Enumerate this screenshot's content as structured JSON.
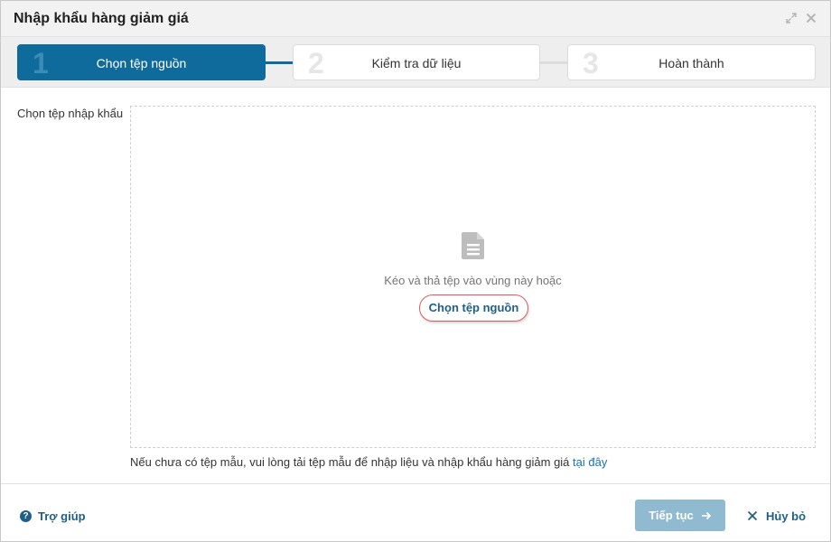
{
  "dialog": {
    "title": "Nhập khẩu hàng giảm giá",
    "expand_icon": "expand-icon",
    "close_icon": "close-icon"
  },
  "steps": [
    {
      "number": "1",
      "label": "Chọn tệp nguồn",
      "active": true
    },
    {
      "number": "2",
      "label": "Kiểm tra dữ liệu",
      "active": false
    },
    {
      "number": "3",
      "label": "Hoàn thành",
      "active": false
    }
  ],
  "upload": {
    "field_label": "Chọn tệp nhập khẩu",
    "drop_text": "Kéo và thả tệp vào vùng này hoặc",
    "choose_label": "Chọn tệp nguồn",
    "file_icon": "document-icon"
  },
  "hint": {
    "text": "Nếu chưa có tệp mẫu, vui lòng tải tệp mẫu để nhập liệu và nhập khẩu hàng giảm giá",
    "link_text": "tại đây"
  },
  "footer": {
    "help_label": "Trợ giúp",
    "help_icon_glyph": "?",
    "next_label": "Tiếp tục",
    "cancel_label": "Hủy bỏ"
  },
  "colors": {
    "primary": "#0e6b9b",
    "link": "#1f5f87",
    "next_disabled": "#8fbad0",
    "highlight_ring": "#e05a5a"
  }
}
